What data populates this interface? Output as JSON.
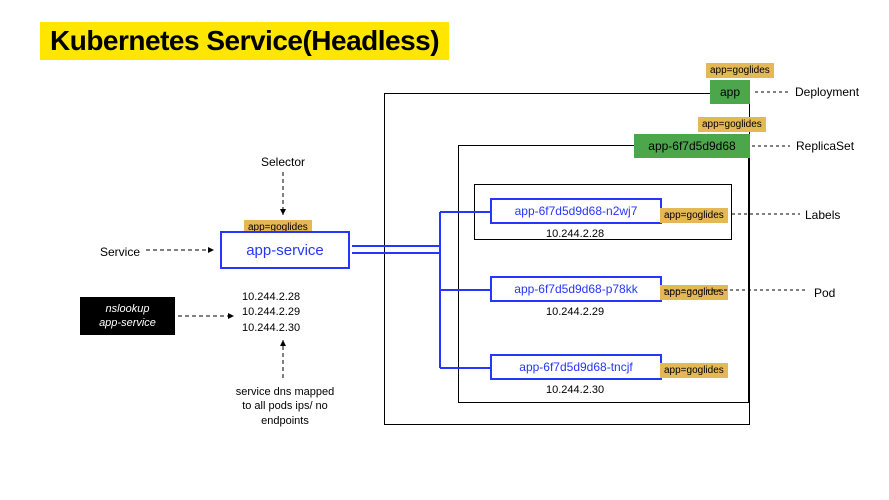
{
  "title": "Kubernetes Service(Headless)",
  "selector_label": "Selector",
  "service_label": "Service",
  "service_box": "app-service",
  "nslookup": {
    "line1": "nslookup",
    "line2": "app-service"
  },
  "ip_list": {
    "ip1": "10.244.2.28",
    "ip2": "10.244.2.29",
    "ip3": "10.244.2.30"
  },
  "dns_caption": {
    "line1": "service dns mapped",
    "line2": "to all pods ips/ no",
    "line3": "endpoints"
  },
  "tag": "app=goglides",
  "deployment_box": "app",
  "replicaset_box": "app-6f7d5d9d68",
  "pods": {
    "p1": {
      "name": "app-6f7d5d9d68-n2wj7",
      "ip": "10.244.2.28"
    },
    "p2": {
      "name": "app-6f7d5d9d68-p78kk",
      "ip": "10.244.2.29"
    },
    "p3": {
      "name": "app-6f7d5d9d68-tncjf",
      "ip": "10.244.2.30"
    }
  },
  "right_labels": {
    "deployment": "Deployment",
    "replicaset": "ReplicaSet",
    "labels": "Labels",
    "pod": "Pod"
  }
}
